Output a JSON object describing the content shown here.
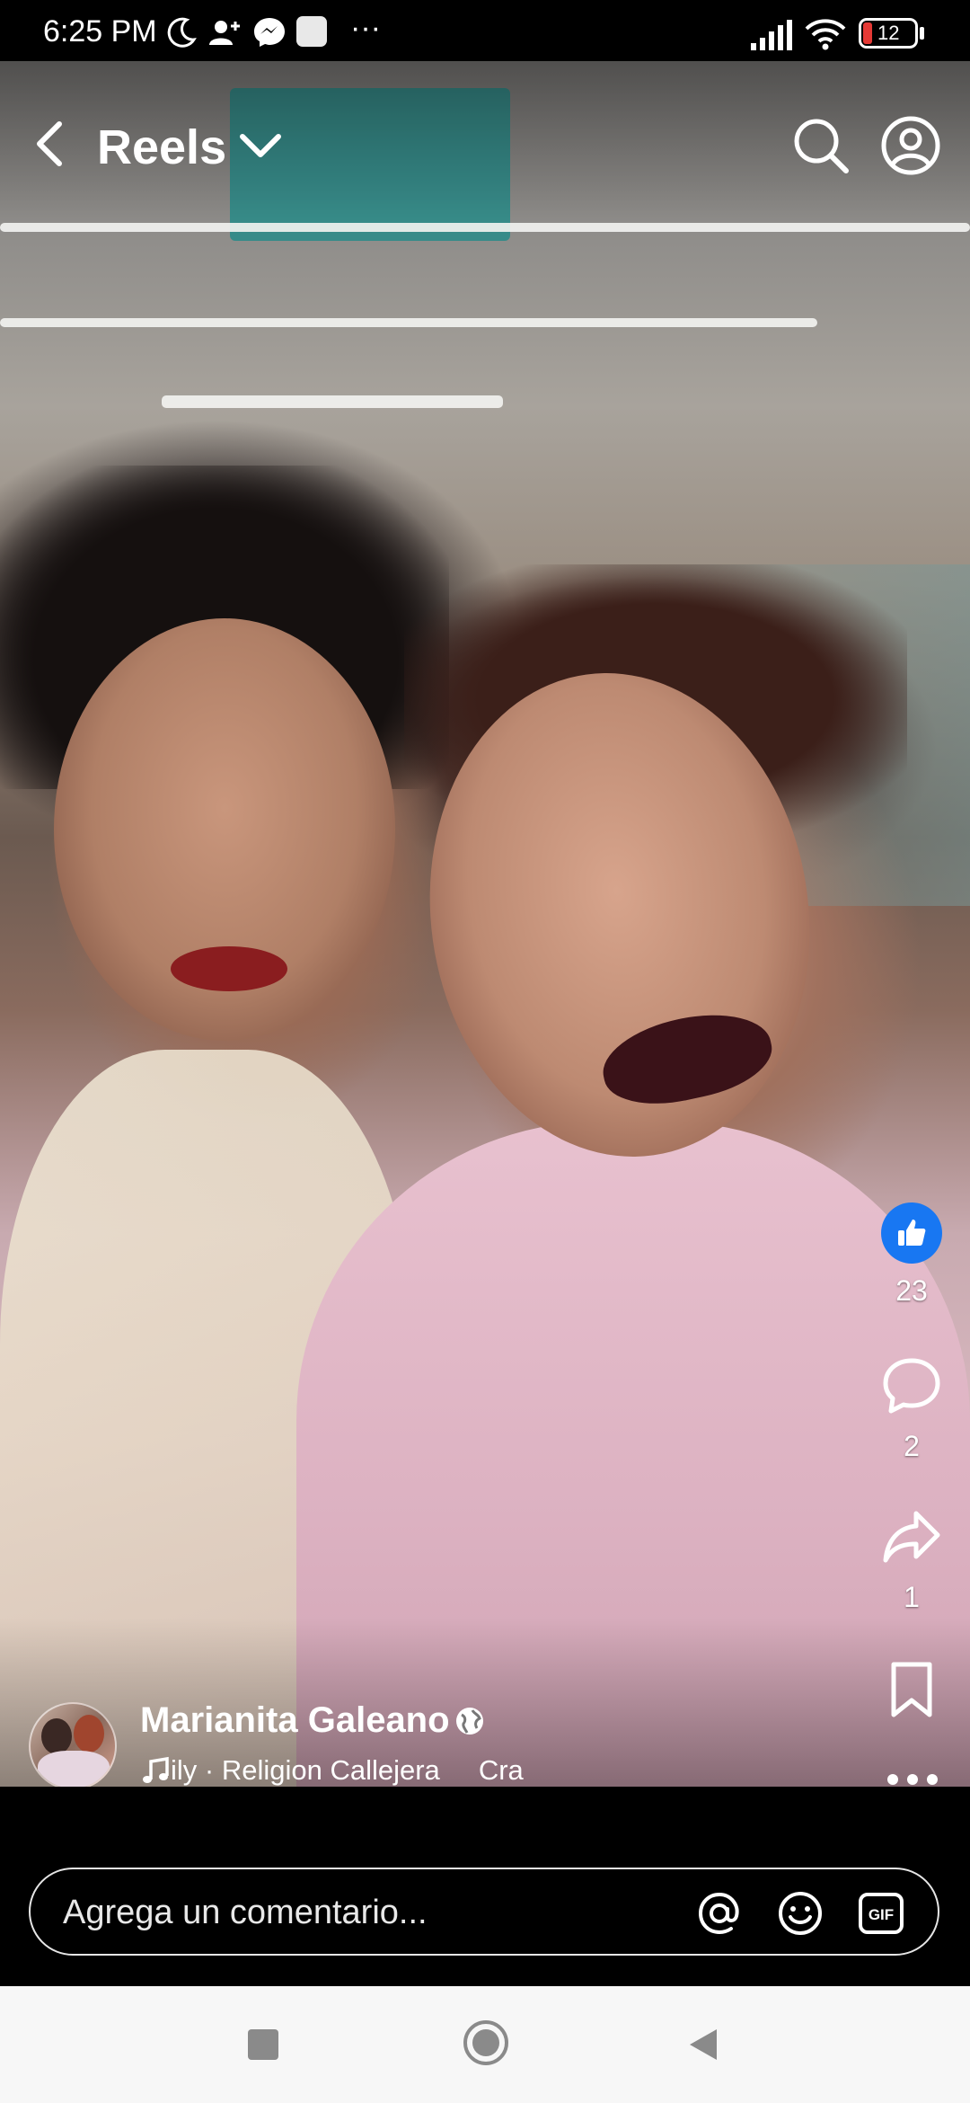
{
  "status_bar": {
    "time": "6:25 PM",
    "more": "···",
    "battery": "12"
  },
  "header": {
    "title": "Reels"
  },
  "actions": {
    "likes": "23",
    "comments": "2",
    "shares": "1"
  },
  "author": {
    "name": "Marianita Galeano"
  },
  "music": {
    "text": "ily · Religion Callejera     Cra"
  },
  "comment": {
    "placeholder": "Agrega un comentario..."
  },
  "colors": {
    "like_blue": "#1877f2",
    "battery_red": "#e53935"
  }
}
